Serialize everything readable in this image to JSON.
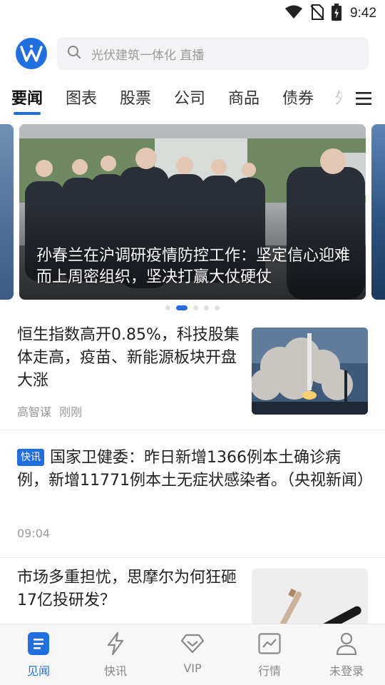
{
  "status_bar": {
    "time": "9:42"
  },
  "header": {
    "search_placeholder": "光伏建筑一体化 直播"
  },
  "tabs": [
    {
      "label": "要闻"
    },
    {
      "label": "图表"
    },
    {
      "label": "股票"
    },
    {
      "label": "公司"
    },
    {
      "label": "商品"
    },
    {
      "label": "债券"
    },
    {
      "label": "外"
    }
  ],
  "active_tab": "要闻",
  "carousel": {
    "caption": "孙春兰在沪调研疫情防控工作：坚定信心迎难而上周密组织，坚决打赢大仗硬仗",
    "current_slide": 2,
    "total_slides": 5
  },
  "news": [
    {
      "title": "恒生指数高开0.85%，科技股集体走高，疫苗、新能源板块开盘大涨",
      "author": "高智谋",
      "time": "刚刚",
      "thumbnail": "rocket-launch-image"
    },
    {
      "badge": "快讯",
      "title": "国家卫健委：昨日新增1366例本土确诊病例，新增11771例本土无症状感染者。（央视新闻）",
      "time": "09:04"
    },
    {
      "title": "市场多重担忧，思摩尔为何狂砸17亿投研发？",
      "thumbnail": "e-cigarette-image"
    }
  ],
  "bottom_nav": [
    {
      "label": "见闻",
      "icon": "document-icon",
      "active": true
    },
    {
      "label": "快讯",
      "icon": "lightning-icon",
      "active": false
    },
    {
      "label": "VIP",
      "icon": "diamond-icon",
      "active": false
    },
    {
      "label": "行情",
      "icon": "chart-icon",
      "active": false
    },
    {
      "label": "未登录",
      "icon": "user-icon",
      "active": false
    }
  ],
  "colors": {
    "accent": "#1f6fe0",
    "text": "#222222",
    "muted": "#999999"
  }
}
